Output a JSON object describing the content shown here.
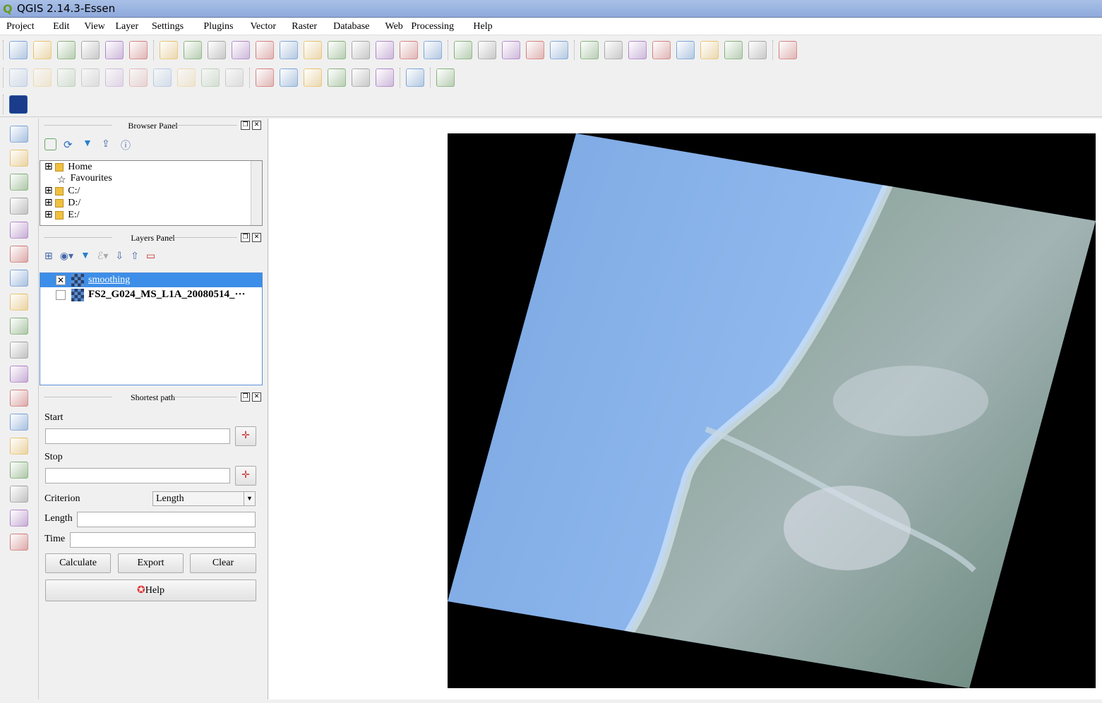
{
  "window": {
    "title": "QGIS 2.14.3-Essen"
  },
  "menu": [
    "Project",
    "Edit",
    "View",
    "Layer",
    "Settings",
    "Plugins",
    "Vector",
    "Raster",
    "Database",
    "Web",
    "Processing",
    "Help"
  ],
  "toolbar1": [
    "new-project",
    "open-project",
    "save-project",
    "save-as",
    "new-print-composer",
    "composer-manager",
    "|",
    "touch-zoom",
    "pan",
    "pan-to-selection",
    "zoom-in",
    "zoom-out",
    "zoom-native",
    "zoom-full",
    "zoom-to-selection",
    "zoom-to-layer",
    "zoom-last",
    "zoom-next",
    "refresh",
    "|",
    "identify",
    "measure-dropdown",
    "select-dropdown",
    "expression-select",
    "deselect",
    "|",
    "attribute-table",
    "field-calculator",
    "statistics",
    "measure-line",
    "map-tips",
    "new-bookmark",
    "show-bookmarks",
    "text-annotation",
    "|",
    "help"
  ],
  "toolbar2": [
    "current-edits",
    "toggle-editing",
    "save-edits",
    "add-feature",
    "node-tool",
    "move-feature",
    "delete-selected",
    "cut-features",
    "copy-features",
    "paste-features",
    "|",
    "label-toolbar",
    "pin-labels",
    "show-hide-labels",
    "move-label",
    "rotate-label",
    "change-label",
    "|",
    "csw",
    "|",
    "python-console"
  ],
  "toolbar3": [
    "openlayers-plugin"
  ],
  "left_toolbar": [
    "add-vector-layer",
    "add-raster-layer",
    "add-postgis-layer",
    "add-spatialite-layer",
    "add-mssql-layer",
    "add-oracle-layer",
    "add-wms-layer",
    "add-wcs-layer",
    "add-wfs-layer",
    "add-delimited-text",
    "new-shapefile",
    "new-spatialite",
    "add-virtual-layer",
    "georeferencer",
    "digitize",
    "snapping",
    "gps",
    "topology"
  ],
  "browser": {
    "title": "Browser Panel",
    "items": [
      {
        "label": "Home",
        "icon": "folder"
      },
      {
        "label": "Favourites",
        "icon": "star"
      },
      {
        "label": "C:/",
        "icon": "folder"
      },
      {
        "label": "D:/",
        "icon": "folder"
      },
      {
        "label": "E:/",
        "icon": "folder"
      }
    ]
  },
  "layers": {
    "title": "Layers Panel",
    "items": [
      {
        "label": "smoothing",
        "checked": true,
        "selected": true
      },
      {
        "label": "FS2_G024_MS_L1A_20080514_···",
        "checked": false,
        "selected": false
      }
    ]
  },
  "shortest_path": {
    "title": "Shortest path",
    "start_label": "Start",
    "start_value": "",
    "stop_label": "Stop",
    "stop_value": "",
    "criterion_label": "Criterion",
    "criterion_value": "Length",
    "length_label": "Length",
    "length_value": "",
    "time_label": "Time",
    "time_value": "",
    "calculate": "Calculate",
    "export": "Export",
    "clear": "Clear",
    "help": "Help"
  }
}
